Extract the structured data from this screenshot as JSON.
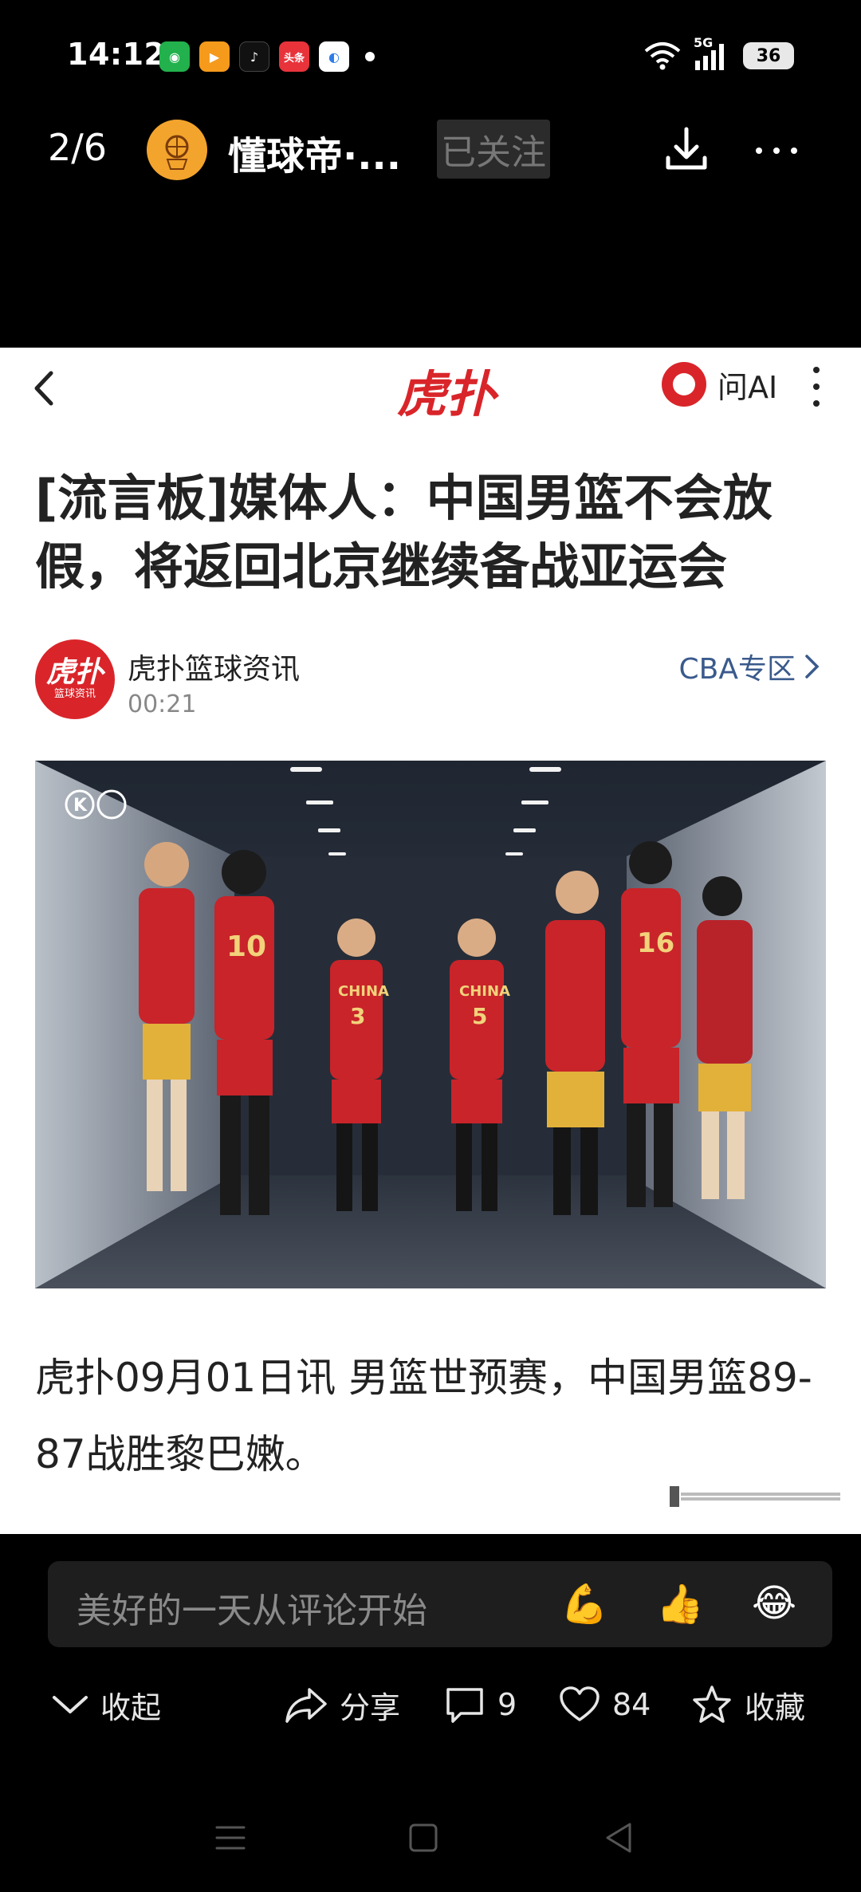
{
  "status_bar": {
    "time": "14:12",
    "apps": [
      {
        "name": "wechat-icon",
        "color": "#22b14c",
        "glyph": "◉"
      },
      {
        "name": "video-app-icon",
        "color": "#f59a1b",
        "glyph": "▶"
      },
      {
        "name": "tiktok-icon",
        "color": "#111111",
        "glyph": "♪"
      },
      {
        "name": "toutiao-icon",
        "color": "#e8333b",
        "glyph": "头条"
      },
      {
        "name": "browser-icon",
        "color": "#2b7de9",
        "glyph": "◐"
      }
    ],
    "network": "5G",
    "battery": "36"
  },
  "top_bar": {
    "page_counter": "2/6",
    "channel_name": "懂球帝·...",
    "follow_label": "已关注"
  },
  "article": {
    "brand": "虎扑",
    "ai_label": "问AI",
    "headline": "[流言板]媒体人：中国男篮不会放假，将返回北京继续备战亚运会",
    "author": {
      "name": "虎扑篮球资讯",
      "time": "00:21",
      "avatar_big": "虎扑",
      "avatar_small": "篮球资讯"
    },
    "category_link": "CBA专区",
    "body": "虎扑09月01日讯 男篮世预赛，中国男篮89-87战胜黎巴嫩。"
  },
  "comment_bar": {
    "placeholder": "美好的一天从评论开始",
    "emojis": [
      "💪",
      "👍",
      "😂"
    ]
  },
  "action_bar": {
    "collapse": "收起",
    "share": "分享",
    "comments": "9",
    "likes": "84",
    "favorite": "收藏"
  },
  "colors": {
    "brand_red": "#d9252a",
    "link_blue": "#3a5a8c"
  }
}
